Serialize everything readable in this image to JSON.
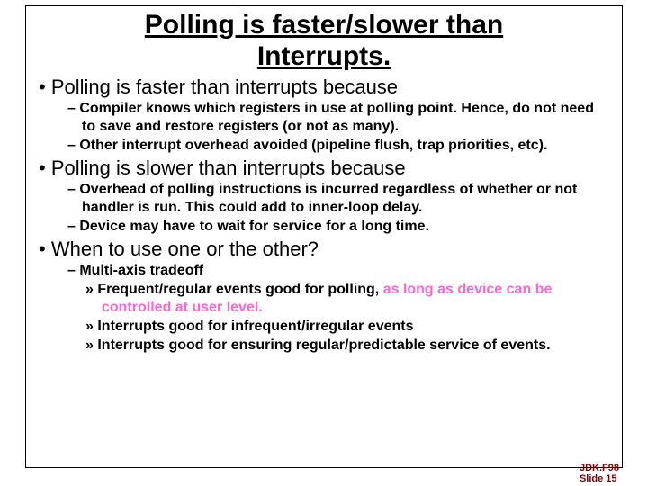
{
  "title_line1": "Polling is faster/slower than",
  "title_line2": "Interrupts.",
  "bullets": {
    "b1": "Polling is faster than interrupts because",
    "b1s1": "Compiler knows which registers in use at polling point.  Hence, do not need to save and restore registers (or not as many).",
    "b1s2": "Other interrupt overhead avoided (pipeline flush, trap priorities, etc).",
    "b2": "Polling is slower than interrupts because",
    "b2s1": "Overhead of polling instructions is incurred regardless of whether or not handler is run.  This could add to inner-loop delay.",
    "b2s2": "Device may have to wait for service for a long time.",
    "b3": "When to use one or the other?",
    "b3s1": "Multi-axis tradeoff",
    "b3s1a_black": "Frequent/regular events good for polling,",
    "b3s1a_pink": " as long as device can be controlled at user level.",
    "b3s1b": "Interrupts good for infrequent/irregular events",
    "b3s1c": "Interrupts good for ensuring regular/predictable service of events."
  },
  "footer": {
    "line1": "JDK.F98",
    "line2": "Slide 15"
  }
}
